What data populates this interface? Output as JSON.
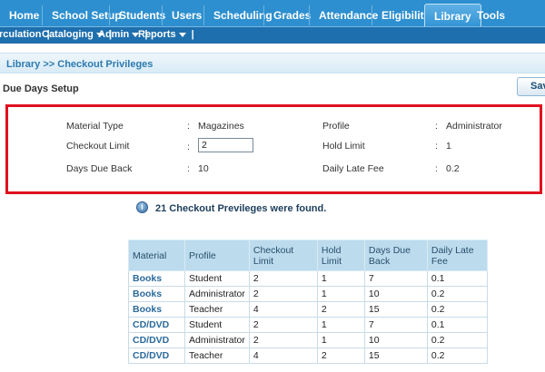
{
  "nav": {
    "tabs": [
      "Home",
      "School Setup",
      "Students",
      "Users",
      "Scheduling",
      "Grades",
      "Attendance",
      "Eligibility",
      "Library",
      "Tools"
    ],
    "active_tab": "Library"
  },
  "submenu": {
    "items": [
      "rculation",
      "Cataloging",
      "Admin",
      "Reports"
    ]
  },
  "breadcrumb": "Library >> Checkout Privileges",
  "page_title": "Due Days Setup",
  "save_label": "Save",
  "form": {
    "material_type_label": "Material Type",
    "material_type_value": "Magazines",
    "profile_label": "Profile",
    "profile_value": "Administrator",
    "checkout_limit_label": "Checkout Limit",
    "checkout_limit_value": "2",
    "hold_limit_label": "Hold Limit",
    "hold_limit_value": "1",
    "days_due_back_label": "Days Due Back",
    "days_due_back_value": "10",
    "daily_late_fee_label": "Daily Late Fee",
    "daily_late_fee_value": "0.2",
    "colon": ":"
  },
  "results_message": "21 Checkout Previleges were found.",
  "table": {
    "headers": {
      "material": "Material",
      "profile": "Profile",
      "checkout_limit_1": "Checkout",
      "checkout_limit_2": "Limit",
      "hold_limit_1": "Hold",
      "hold_limit_2": "Limit",
      "days_due_back_1": "Days Due",
      "days_due_back_2": "Back",
      "daily_late_fee_1": "Daily Late",
      "daily_late_fee_2": "Fee"
    },
    "rows": [
      {
        "material": "Books",
        "profile": "Student",
        "checkout": "2",
        "hold": "1",
        "days": "7",
        "fee": "0.1"
      },
      {
        "material": "Books",
        "profile": "Administrator",
        "checkout": "2",
        "hold": "1",
        "days": "10",
        "fee": "0.2"
      },
      {
        "material": "Books",
        "profile": "Teacher",
        "checkout": "4",
        "hold": "2",
        "days": "15",
        "fee": "0.2"
      },
      {
        "material": "CD/DVD",
        "profile": "Student",
        "checkout": "2",
        "hold": "1",
        "days": "7",
        "fee": "0.1"
      },
      {
        "material": "CD/DVD",
        "profile": "Administrator",
        "checkout": "2",
        "hold": "1",
        "days": "10",
        "fee": "0.2"
      },
      {
        "material": "CD/DVD",
        "profile": "Teacher",
        "checkout": "4",
        "hold": "2",
        "days": "15",
        "fee": "0.2"
      }
    ]
  },
  "colors": {
    "tab_bar": "#2d8fcf",
    "submenu": "#1e6fae",
    "highlight_border": "#e0101e",
    "table_header": "#bcdcee"
  }
}
